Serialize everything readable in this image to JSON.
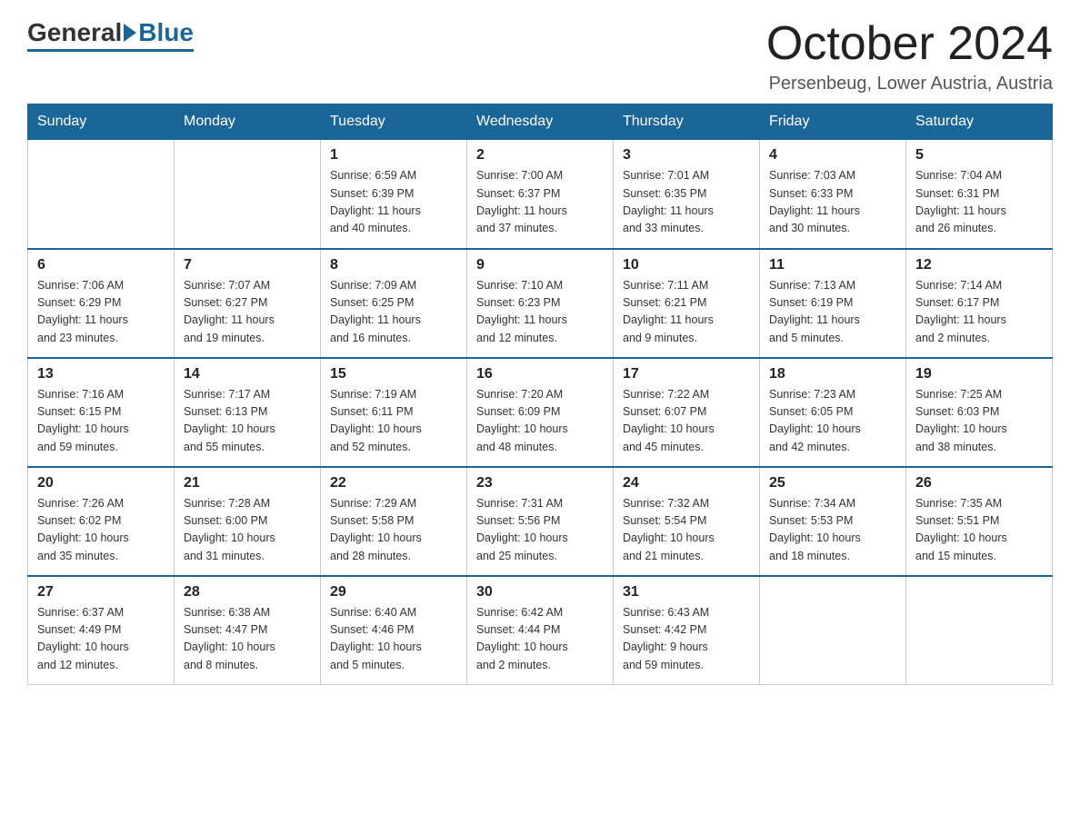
{
  "logo": {
    "general": "General",
    "blue": "Blue"
  },
  "header": {
    "month": "October 2024",
    "location": "Persenbeug, Lower Austria, Austria"
  },
  "weekdays": [
    "Sunday",
    "Monday",
    "Tuesday",
    "Wednesday",
    "Thursday",
    "Friday",
    "Saturday"
  ],
  "weeks": [
    [
      {
        "day": "",
        "info": ""
      },
      {
        "day": "",
        "info": ""
      },
      {
        "day": "1",
        "info": "Sunrise: 6:59 AM\nSunset: 6:39 PM\nDaylight: 11 hours\nand 40 minutes."
      },
      {
        "day": "2",
        "info": "Sunrise: 7:00 AM\nSunset: 6:37 PM\nDaylight: 11 hours\nand 37 minutes."
      },
      {
        "day": "3",
        "info": "Sunrise: 7:01 AM\nSunset: 6:35 PM\nDaylight: 11 hours\nand 33 minutes."
      },
      {
        "day": "4",
        "info": "Sunrise: 7:03 AM\nSunset: 6:33 PM\nDaylight: 11 hours\nand 30 minutes."
      },
      {
        "day": "5",
        "info": "Sunrise: 7:04 AM\nSunset: 6:31 PM\nDaylight: 11 hours\nand 26 minutes."
      }
    ],
    [
      {
        "day": "6",
        "info": "Sunrise: 7:06 AM\nSunset: 6:29 PM\nDaylight: 11 hours\nand 23 minutes."
      },
      {
        "day": "7",
        "info": "Sunrise: 7:07 AM\nSunset: 6:27 PM\nDaylight: 11 hours\nand 19 minutes."
      },
      {
        "day": "8",
        "info": "Sunrise: 7:09 AM\nSunset: 6:25 PM\nDaylight: 11 hours\nand 16 minutes."
      },
      {
        "day": "9",
        "info": "Sunrise: 7:10 AM\nSunset: 6:23 PM\nDaylight: 11 hours\nand 12 minutes."
      },
      {
        "day": "10",
        "info": "Sunrise: 7:11 AM\nSunset: 6:21 PM\nDaylight: 11 hours\nand 9 minutes."
      },
      {
        "day": "11",
        "info": "Sunrise: 7:13 AM\nSunset: 6:19 PM\nDaylight: 11 hours\nand 5 minutes."
      },
      {
        "day": "12",
        "info": "Sunrise: 7:14 AM\nSunset: 6:17 PM\nDaylight: 11 hours\nand 2 minutes."
      }
    ],
    [
      {
        "day": "13",
        "info": "Sunrise: 7:16 AM\nSunset: 6:15 PM\nDaylight: 10 hours\nand 59 minutes."
      },
      {
        "day": "14",
        "info": "Sunrise: 7:17 AM\nSunset: 6:13 PM\nDaylight: 10 hours\nand 55 minutes."
      },
      {
        "day": "15",
        "info": "Sunrise: 7:19 AM\nSunset: 6:11 PM\nDaylight: 10 hours\nand 52 minutes."
      },
      {
        "day": "16",
        "info": "Sunrise: 7:20 AM\nSunset: 6:09 PM\nDaylight: 10 hours\nand 48 minutes."
      },
      {
        "day": "17",
        "info": "Sunrise: 7:22 AM\nSunset: 6:07 PM\nDaylight: 10 hours\nand 45 minutes."
      },
      {
        "day": "18",
        "info": "Sunrise: 7:23 AM\nSunset: 6:05 PM\nDaylight: 10 hours\nand 42 minutes."
      },
      {
        "day": "19",
        "info": "Sunrise: 7:25 AM\nSunset: 6:03 PM\nDaylight: 10 hours\nand 38 minutes."
      }
    ],
    [
      {
        "day": "20",
        "info": "Sunrise: 7:26 AM\nSunset: 6:02 PM\nDaylight: 10 hours\nand 35 minutes."
      },
      {
        "day": "21",
        "info": "Sunrise: 7:28 AM\nSunset: 6:00 PM\nDaylight: 10 hours\nand 31 minutes."
      },
      {
        "day": "22",
        "info": "Sunrise: 7:29 AM\nSunset: 5:58 PM\nDaylight: 10 hours\nand 28 minutes."
      },
      {
        "day": "23",
        "info": "Sunrise: 7:31 AM\nSunset: 5:56 PM\nDaylight: 10 hours\nand 25 minutes."
      },
      {
        "day": "24",
        "info": "Sunrise: 7:32 AM\nSunset: 5:54 PM\nDaylight: 10 hours\nand 21 minutes."
      },
      {
        "day": "25",
        "info": "Sunrise: 7:34 AM\nSunset: 5:53 PM\nDaylight: 10 hours\nand 18 minutes."
      },
      {
        "day": "26",
        "info": "Sunrise: 7:35 AM\nSunset: 5:51 PM\nDaylight: 10 hours\nand 15 minutes."
      }
    ],
    [
      {
        "day": "27",
        "info": "Sunrise: 6:37 AM\nSunset: 4:49 PM\nDaylight: 10 hours\nand 12 minutes."
      },
      {
        "day": "28",
        "info": "Sunrise: 6:38 AM\nSunset: 4:47 PM\nDaylight: 10 hours\nand 8 minutes."
      },
      {
        "day": "29",
        "info": "Sunrise: 6:40 AM\nSunset: 4:46 PM\nDaylight: 10 hours\nand 5 minutes."
      },
      {
        "day": "30",
        "info": "Sunrise: 6:42 AM\nSunset: 4:44 PM\nDaylight: 10 hours\nand 2 minutes."
      },
      {
        "day": "31",
        "info": "Sunrise: 6:43 AM\nSunset: 4:42 PM\nDaylight: 9 hours\nand 59 minutes."
      },
      {
        "day": "",
        "info": ""
      },
      {
        "day": "",
        "info": ""
      }
    ]
  ]
}
